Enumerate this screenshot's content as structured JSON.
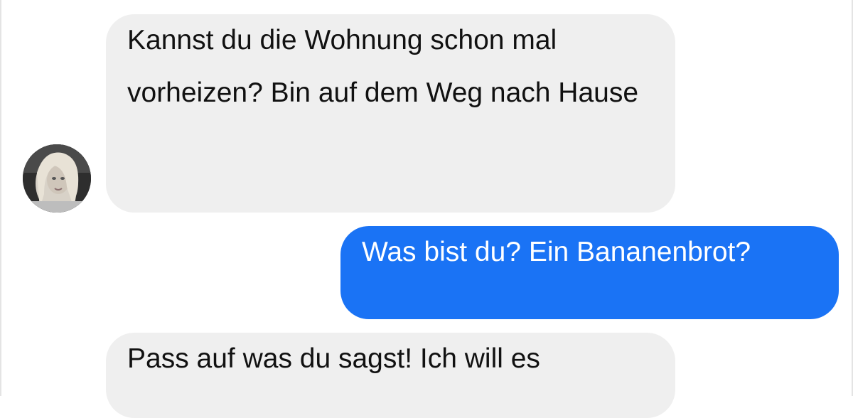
{
  "messages": [
    {
      "direction": "incoming",
      "text": "Kannst du die Wohnung schon mal vorheizen? Bin auf dem Weg nach Hause"
    },
    {
      "direction": "outgoing",
      "text": "Was bist du? Ein Bananenbrot?"
    },
    {
      "direction": "incoming",
      "text": "Pass auf was du sagst! Ich will es"
    }
  ],
  "colors": {
    "incoming_bubble": "#efefef",
    "outgoing_bubble": "#1a73f5",
    "text_dark": "#111111",
    "text_light": "#ffffff"
  },
  "icons": {
    "avatar": "contact-avatar-photo"
  }
}
